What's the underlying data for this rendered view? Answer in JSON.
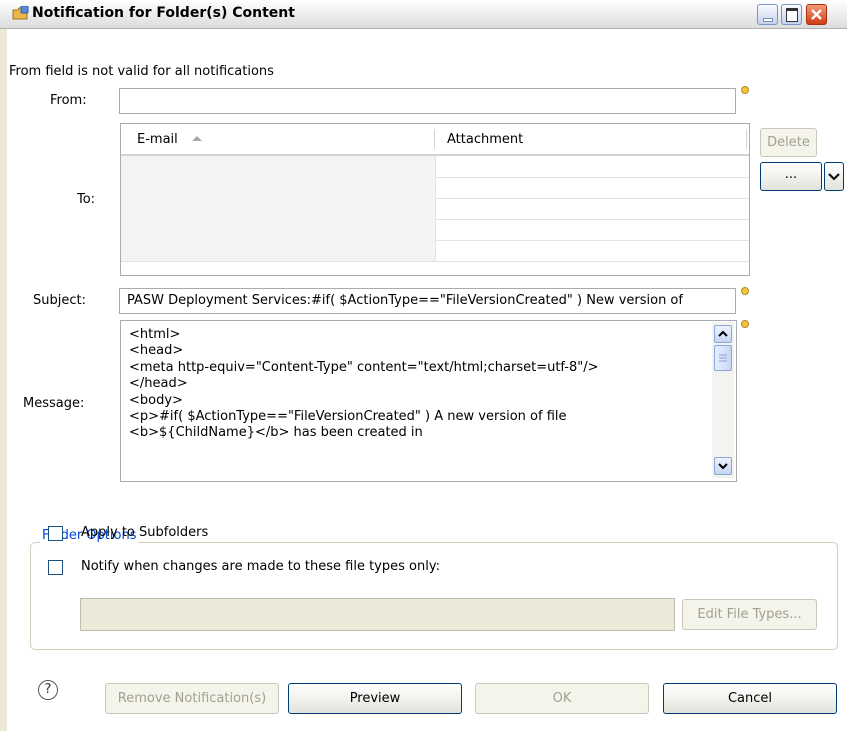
{
  "window": {
    "title": "Notification for Folder(s) Content"
  },
  "validation_message": "From field is not valid  for all notifications",
  "from": {
    "label": "From:",
    "value": ""
  },
  "to": {
    "label": "To:",
    "columns": [
      {
        "label": "E-mail",
        "sort": "ascending"
      },
      {
        "label": "Attachment"
      }
    ],
    "rows": [
      {
        "email": "",
        "attachment": ""
      },
      {
        "email": "",
        "attachment": ""
      },
      {
        "email": "",
        "attachment": ""
      },
      {
        "email": "",
        "attachment": ""
      },
      {
        "email": "",
        "attachment": ""
      }
    ],
    "delete_button": "Delete",
    "browse_button": "...",
    "dropdown_icon": "chevron-down-icon"
  },
  "subject": {
    "label": "Subject:",
    "value": "PASW Deployment Services:#if( $ActionType==\"FileVersionCreated\" ) New version of"
  },
  "message": {
    "label": "Message:",
    "lines": [
      "<html>",
      "<head>",
      "<meta http-equiv=\"Content-Type\" content=\"text/html;charset=utf-8\"/>",
      "</head>",
      "<body>",
      "<p>#if( $ActionType==\"FileVersionCreated\" ) A new version of file",
      "<b>${ChildName}</b> has been created in"
    ]
  },
  "folder_options": {
    "title": "Folder Options",
    "apply_subfolders": {
      "label": "Apply to Subfolders",
      "checked": false
    },
    "notify_filetypes": {
      "label": "Notify when changes are made to these file types only:",
      "checked": false
    },
    "file_types_value": "",
    "edit_file_types_button": "Edit File Types..."
  },
  "footer": {
    "help_glyph": "?",
    "remove_button": "Remove Notification(s)",
    "preview_button": "Preview",
    "ok_button": "OK",
    "cancel_button": "Cancel"
  },
  "colors": {
    "dialog_bg": "#ffffff",
    "frame_bg": "#ece9d8",
    "group_title": "#0046d5",
    "button_border": "#003c74",
    "close_button": "#d03c15"
  }
}
